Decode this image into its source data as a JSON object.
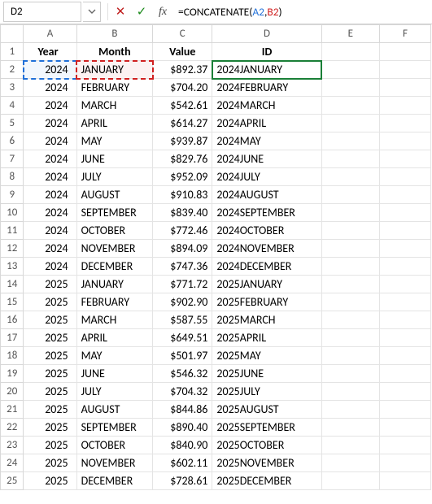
{
  "formula_bar": {
    "name_box": "D2",
    "cancel_glyph": "✕",
    "accept_glyph": "✓",
    "fx_glyph": "fx",
    "formula_prefix": "=",
    "formula_fn": "CONCATENATE",
    "formula_open": "(",
    "formula_ref1": "A2",
    "formula_comma": ",",
    "formula_ref2": "B2",
    "formula_close": ")"
  },
  "columns": [
    "A",
    "B",
    "C",
    "D",
    "E",
    "F"
  ],
  "headers": {
    "year": "Year",
    "month": "Month",
    "value": "Value",
    "id": "ID"
  },
  "rows": [
    {
      "n": 1
    },
    {
      "n": 2,
      "year": "2024",
      "month": "JANUARY",
      "value": "$892.37",
      "id": "2024JANUARY"
    },
    {
      "n": 3,
      "year": "2024",
      "month": "FEBRUARY",
      "value": "$704.20",
      "id": "2024FEBRUARY"
    },
    {
      "n": 4,
      "year": "2024",
      "month": "MARCH",
      "value": "$542.61",
      "id": "2024MARCH"
    },
    {
      "n": 5,
      "year": "2024",
      "month": "APRIL",
      "value": "$614.27",
      "id": "2024APRIL"
    },
    {
      "n": 6,
      "year": "2024",
      "month": "MAY",
      "value": "$939.87",
      "id": "2024MAY"
    },
    {
      "n": 7,
      "year": "2024",
      "month": "JUNE",
      "value": "$829.76",
      "id": "2024JUNE"
    },
    {
      "n": 8,
      "year": "2024",
      "month": "JULY",
      "value": "$952.09",
      "id": "2024JULY"
    },
    {
      "n": 9,
      "year": "2024",
      "month": "AUGUST",
      "value": "$910.83",
      "id": "2024AUGUST"
    },
    {
      "n": 10,
      "year": "2024",
      "month": "SEPTEMBER",
      "value": "$839.40",
      "id": "2024SEPTEMBER"
    },
    {
      "n": 11,
      "year": "2024",
      "month": "OCTOBER",
      "value": "$772.46",
      "id": "2024OCTOBER"
    },
    {
      "n": 12,
      "year": "2024",
      "month": "NOVEMBER",
      "value": "$894.09",
      "id": "2024NOVEMBER"
    },
    {
      "n": 13,
      "year": "2024",
      "month": "DECEMBER",
      "value": "$747.36",
      "id": "2024DECEMBER"
    },
    {
      "n": 14,
      "year": "2025",
      "month": "JANUARY",
      "value": "$771.72",
      "id": "2025JANUARY"
    },
    {
      "n": 15,
      "year": "2025",
      "month": "FEBRUARY",
      "value": "$902.90",
      "id": "2025FEBRUARY"
    },
    {
      "n": 16,
      "year": "2025",
      "month": "MARCH",
      "value": "$587.55",
      "id": "2025MARCH"
    },
    {
      "n": 17,
      "year": "2025",
      "month": "APRIL",
      "value": "$649.51",
      "id": "2025APRIL"
    },
    {
      "n": 18,
      "year": "2025",
      "month": "MAY",
      "value": "$501.97",
      "id": "2025MAY"
    },
    {
      "n": 19,
      "year": "2025",
      "month": "JUNE",
      "value": "$546.32",
      "id": "2025JUNE"
    },
    {
      "n": 20,
      "year": "2025",
      "month": "JULY",
      "value": "$704.32",
      "id": "2025JULY"
    },
    {
      "n": 21,
      "year": "2025",
      "month": "AUGUST",
      "value": "$844.86",
      "id": "2025AUGUST"
    },
    {
      "n": 22,
      "year": "2025",
      "month": "SEPTEMBER",
      "value": "$890.40",
      "id": "2025SEPTEMBER"
    },
    {
      "n": 23,
      "year": "2025",
      "month": "OCTOBER",
      "value": "$840.90",
      "id": "2025OCTOBER"
    },
    {
      "n": 24,
      "year": "2025",
      "month": "NOVEMBER",
      "value": "$602.11",
      "id": "2025NOVEMBER"
    },
    {
      "n": 25,
      "year": "2025",
      "month": "DECEMBER",
      "value": "$728.61",
      "id": "2025DECEMBER"
    }
  ]
}
